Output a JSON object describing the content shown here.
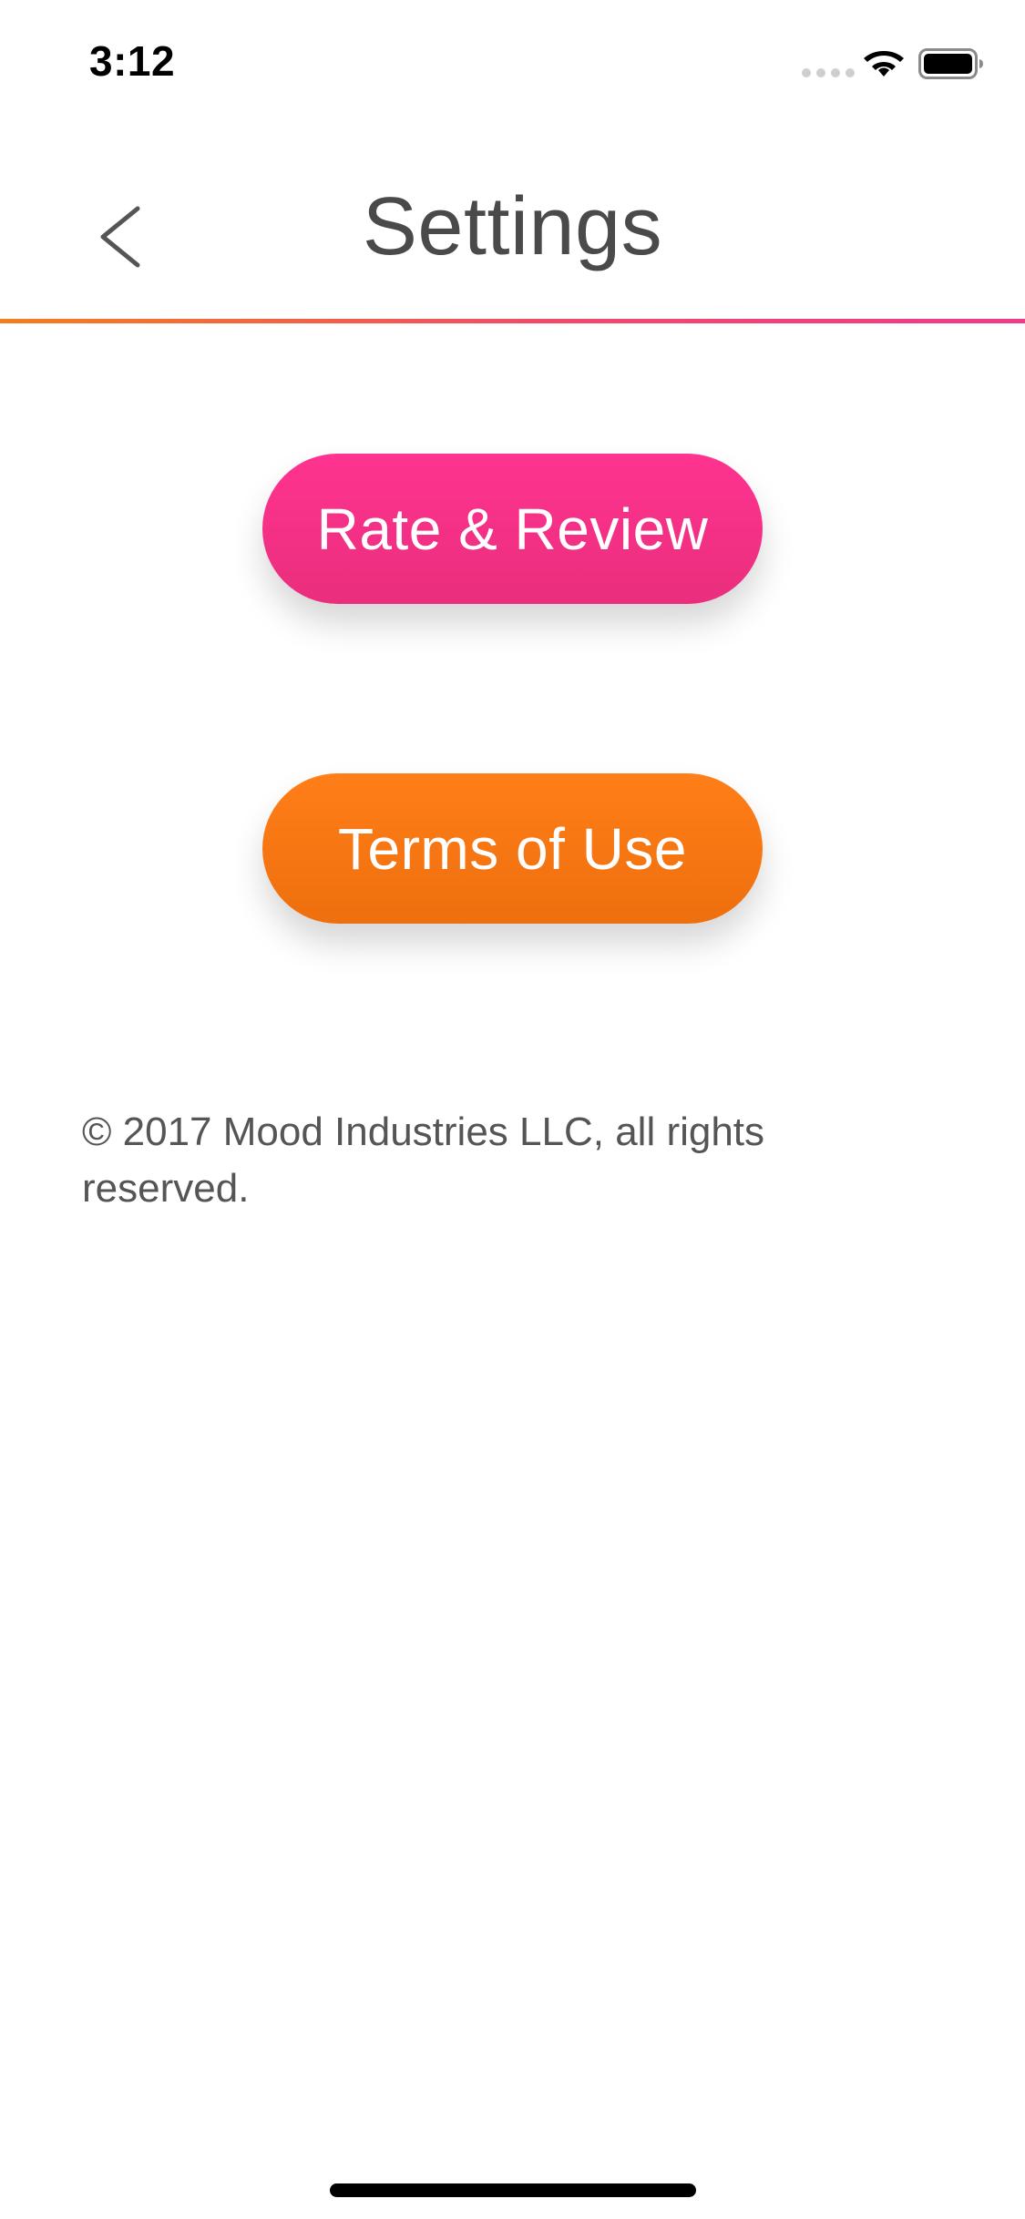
{
  "status_bar": {
    "time": "3:12"
  },
  "header": {
    "title": "Settings",
    "back_icon": "chevron-left-icon"
  },
  "buttons": {
    "rate_review": {
      "label": "Rate & Review",
      "color_top": "#ff3390",
      "color_bottom": "#ea2e7c"
    },
    "terms_of_use": {
      "label": "Terms of Use",
      "color_top": "#ff7e18",
      "color_bottom": "#ee6f0e"
    }
  },
  "footer": {
    "copyright": "© 2017 Mood Industries LLC, all rights reserved."
  },
  "colors": {
    "divider_start": "#f57e1c",
    "divider_end": "#ee3b8b",
    "title_text": "#4a4a4a"
  }
}
